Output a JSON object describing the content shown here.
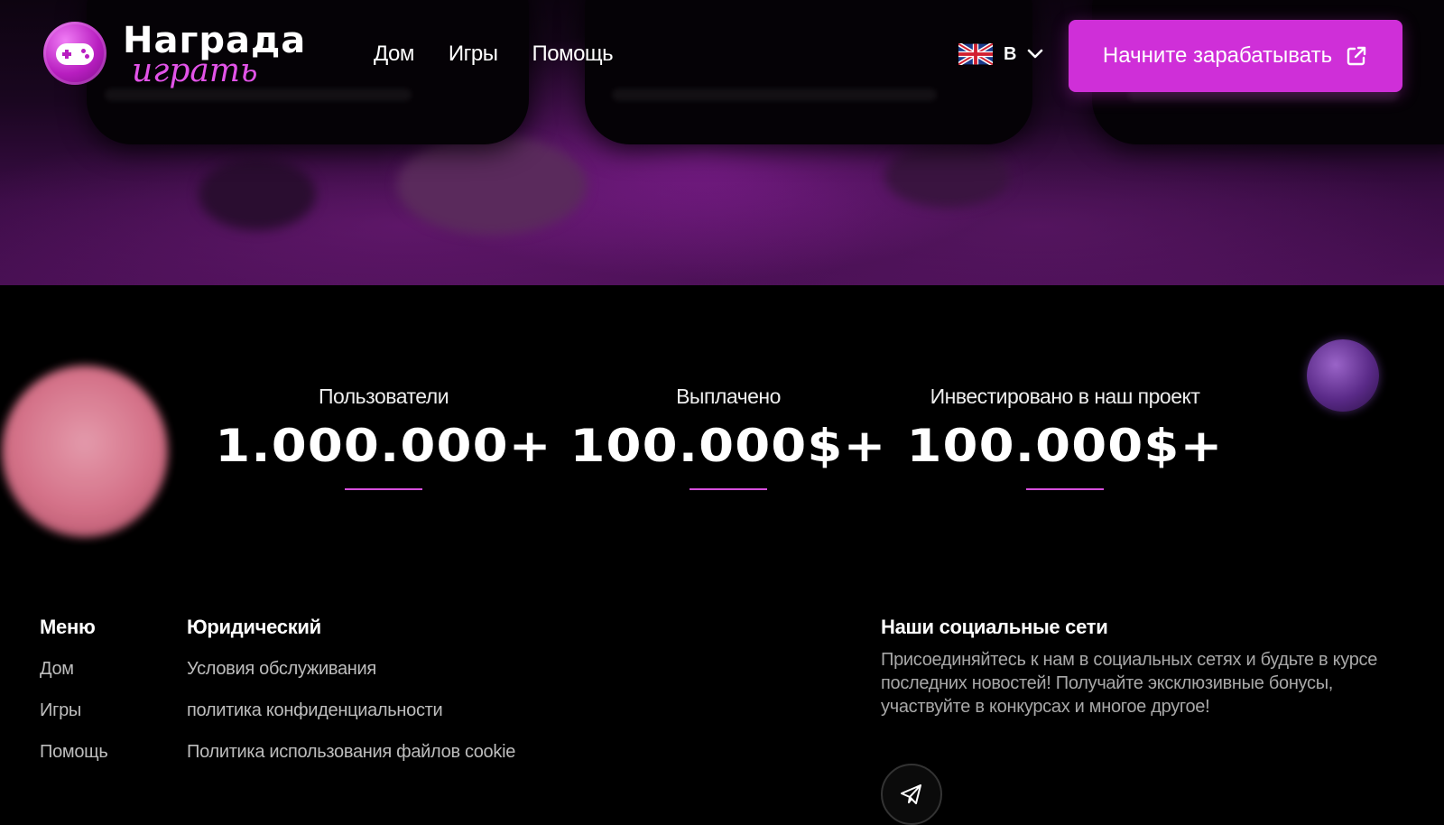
{
  "logo": {
    "title": "Награда",
    "subtitle": "играть"
  },
  "nav": {
    "items": [
      "Дом",
      "Игры",
      "Помощь"
    ]
  },
  "language": {
    "code": "В",
    "flag": "uk-flag-icon"
  },
  "cta": {
    "label": "Начните зарабатывать",
    "icon": "external-link-icon"
  },
  "stats": [
    {
      "label": "Пользователи",
      "value": "1.000.000+"
    },
    {
      "label": "Выплачено",
      "value": "100.000$+"
    },
    {
      "label": "Инвестировано в наш проект",
      "value": "100.000$+"
    }
  ],
  "footer": {
    "menu": {
      "title": "Меню",
      "links": [
        "Дом",
        "Игры",
        "Помощь"
      ]
    },
    "legal": {
      "title": "Юридический",
      "links": [
        "Условия обслуживания",
        "политика конфиденциальности",
        "Политика использования файлов cookie"
      ]
    },
    "social": {
      "title": "Наши социальные сети",
      "text": "Присоединяйтесь к нам в социальных сетях и будьте в курсе последних новостей! Получайте эксклюзивные бонусы, участвуйте в конкурсах и многое другое!",
      "icon": "telegram-icon"
    }
  },
  "colors": {
    "accent": "#cf2fd8",
    "underline": "#d64fdc",
    "background": "#000000"
  }
}
